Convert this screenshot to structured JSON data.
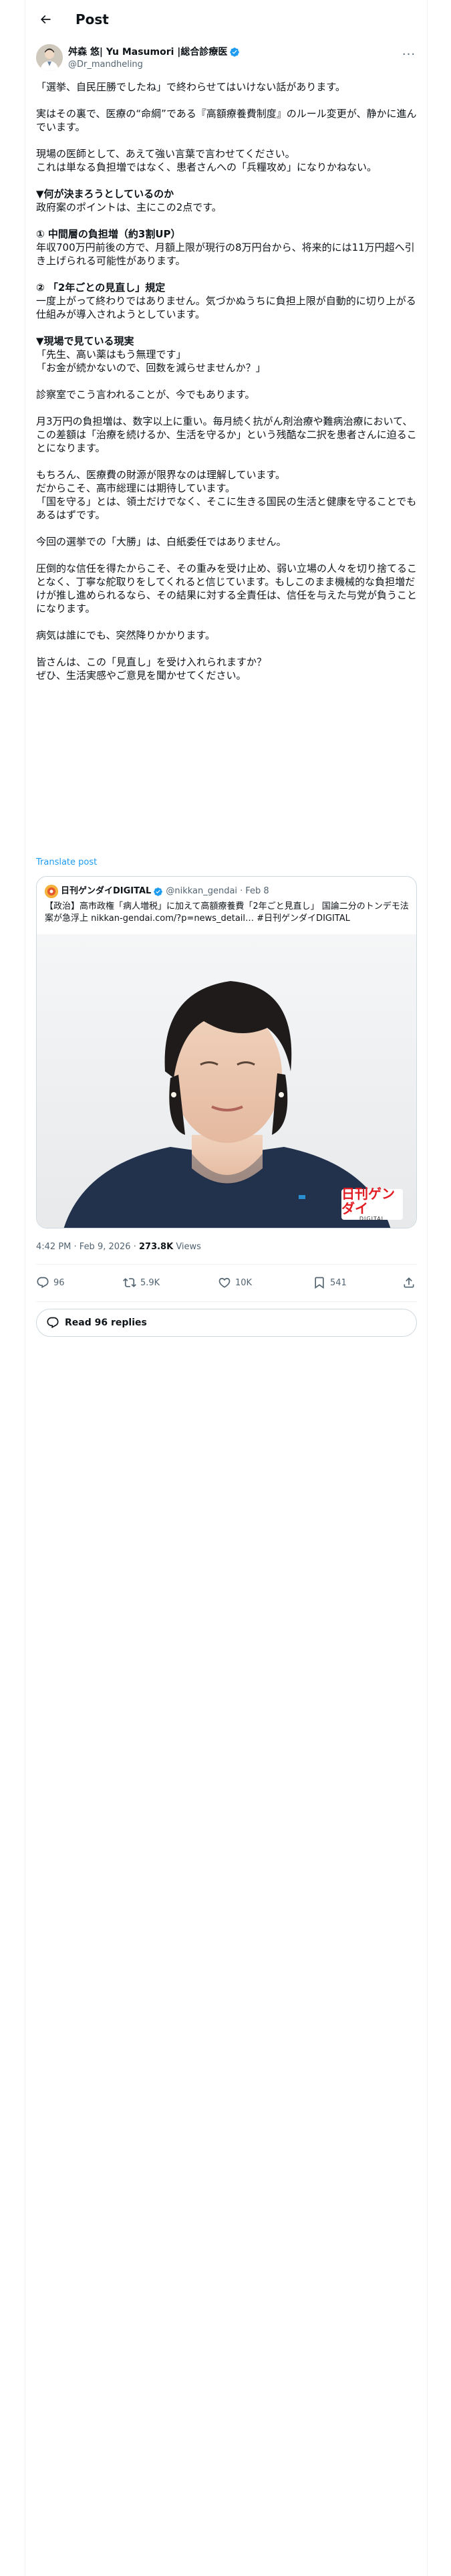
{
  "header": {
    "title": "Post",
    "back_icon": "back-arrow-icon"
  },
  "author": {
    "name": "舛森 悠| Yu Masumori |総合診療医",
    "handle": "@Dr_mandheling",
    "verified": true,
    "verified_color": "#1d9bf0"
  },
  "post": {
    "paragraphs": [
      {
        "text": "「選挙、自民圧勝でしたね」で終わらせてはいけない話があります。",
        "bold": false
      },
      {
        "text": "",
        "bold": false
      },
      {
        "text": "実はその裏で、医療の“命綱”である『高額療養費制度』のルール変更が、静かに進んでいます。",
        "bold": false
      },
      {
        "text": "",
        "bold": false
      },
      {
        "text": "現場の医師として、あえて強い言葉で言わせてください。\nこれは単なる負担増ではなく、患者さんへの「兵糧攻め」になりかねない。",
        "bold": false
      },
      {
        "text": "",
        "bold": false
      },
      {
        "text": "▼何が決まろうとしているのか",
        "bold": true
      },
      {
        "text": "政府案のポイントは、主にこの2点です。",
        "bold": false
      },
      {
        "text": "",
        "bold": false
      },
      {
        "text": "① 中間層の負担増（約3割UP）",
        "bold": true
      },
      {
        "text": "年収700万円前後の方で、月額上限が現行の8万円台から、将来的には11万円超へ引き上げられる可能性があります。",
        "bold": false
      },
      {
        "text": "",
        "bold": false
      },
      {
        "text": "② 「2年ごとの見直し」規定",
        "bold": true
      },
      {
        "text": "一度上がって終わりではありません。気づかぬうちに負担上限が自動的に切り上がる仕組みが導入されようとしています。",
        "bold": false
      },
      {
        "text": "",
        "bold": false
      },
      {
        "text": "▼現場で見ている現実",
        "bold": true
      },
      {
        "text": "「先生、高い薬はもう無理です」\n「お金が続かないので、回数を減らせませんか？」",
        "bold": false
      },
      {
        "text": "",
        "bold": false
      },
      {
        "text": "診察室でこう言われることが、今でもあります。",
        "bold": false
      },
      {
        "text": "",
        "bold": false
      },
      {
        "text": "月3万円の負担増は、数字以上に重い。毎月続く抗がん剤治療や難病治療において、この差額は「治療を続けるか、生活を守るか」という残酷な二択を患者さんに迫ることになります。",
        "bold": false
      },
      {
        "text": "",
        "bold": false
      },
      {
        "text": "もちろん、医療費の財源が限界なのは理解しています。\nだからこそ、高市総理には期待しています。\n「国を守る」とは、領土だけでなく、そこに生きる国民の生活と健康を守ることでもあるはずです。",
        "bold": false
      },
      {
        "text": "",
        "bold": false
      },
      {
        "text": "今回の選挙での「大勝」は、白紙委任ではありません。",
        "bold": false
      },
      {
        "text": "",
        "bold": false
      },
      {
        "text": "圧倒的な信任を得たからこそ、その重みを受け止め、弱い立場の人々を切り捨てることなく、丁寧な舵取りをしてくれると信じています。もしこのまま機械的な負担増だけが推し進められるなら、その結果に対する全責任は、信任を与えた与党が負うことになります。",
        "bold": false
      },
      {
        "text": "",
        "bold": false
      },
      {
        "text": "病気は誰にでも、突然降りかかります。",
        "bold": false
      },
      {
        "text": "",
        "bold": false
      },
      {
        "text": "皆さんは、この「見直し」を受け入れられますか？\nぜひ、生活実感やご意見を聞かせてください。",
        "bold": false
      }
    ],
    "translate_label": "Translate post"
  },
  "quote": {
    "name": "日刊ゲンダイDIGITAL",
    "handle": "@nikkan_gendai",
    "date": "Feb 8",
    "text": "【政治】高市政権「病人増税」に加えて高額療養費「2年ごと見直し」 国論二分のトンデモ法案が急浮上 nikkan-gendai.com/?p=news_detail… #日刊ゲンダイDIGITAL",
    "logo_main": "日刊ゲンダイ",
    "logo_sub": "DIGITAL"
  },
  "meta": {
    "time": "4:42 PM",
    "date": "Feb 9, 2026",
    "views_count": "273.8K",
    "views_label": "Views"
  },
  "actions": {
    "replies": "96",
    "reposts": "5.9K",
    "likes": "10K",
    "bookmarks": "541"
  },
  "read_replies_label": "Read 96 replies"
}
